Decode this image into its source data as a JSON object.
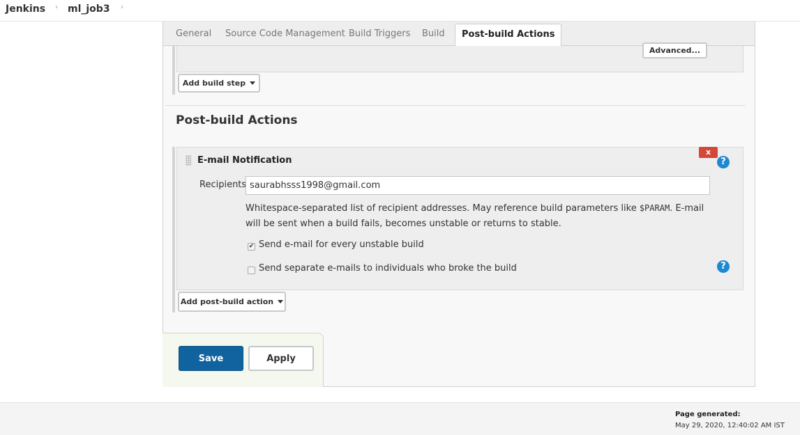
{
  "breadcrumb": {
    "items": [
      {
        "label": "Jenkins"
      },
      {
        "label": "ml_job3"
      }
    ],
    "separator": "›"
  },
  "tabs": [
    {
      "label": "General",
      "active": false
    },
    {
      "label": "Source Code Management",
      "active": false
    },
    {
      "label": "Build Triggers",
      "active": false
    },
    {
      "label": "Build",
      "active": false
    },
    {
      "label": "Post-build Actions",
      "active": true
    }
  ],
  "build": {
    "advanced_label": "Advanced...",
    "add_step_label": "Add build step"
  },
  "post_build": {
    "title": "Post-build Actions",
    "email": {
      "title": "E-mail Notification",
      "delete_label": "x",
      "recipients_label": "Recipients",
      "recipients_value": "saurabhsss1998@gmail.com",
      "help_before": "Whitespace-separated list of recipient addresses. May reference build parameters like ",
      "help_code": "$PARAM",
      "help_after": ". E-mail will be sent when a build fails, becomes unstable or returns to stable.",
      "checkbox_unstable_label": "Send e-mail for every unstable build",
      "checkbox_unstable_checked": true,
      "checkbox_individuals_label": "Send separate e-mails to individuals who broke the build",
      "checkbox_individuals_checked": false
    },
    "add_action_label": "Add post-build action"
  },
  "actions": {
    "save_label": "Save",
    "apply_label": "Apply"
  },
  "footer": {
    "title": "Page generated:",
    "timestamp": "May 29, 2020, 12:40:02 AM IST"
  },
  "icons": {
    "help": "help-icon",
    "caret": "caret-down-icon",
    "drag": "drag-handle-icon"
  },
  "colors": {
    "primary": "#10639f",
    "danger": "#d24939",
    "help": "#1e88d0"
  }
}
